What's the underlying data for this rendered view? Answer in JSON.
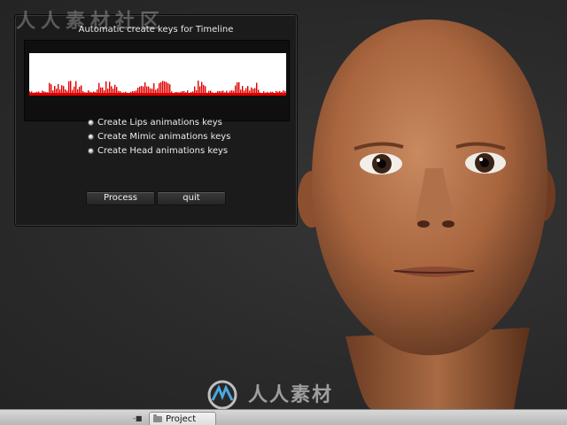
{
  "panel": {
    "title": "Automatic create keys for Timeline",
    "options": [
      {
        "label": "Create Lips animations keys",
        "selected": true
      },
      {
        "label": "Create Mimic animations keys",
        "selected": true
      },
      {
        "label": "Create Head animations keys",
        "selected": true
      }
    ],
    "buttons": {
      "process": "Process",
      "quit": "quit"
    }
  },
  "statusbar": {
    "collapse_glyph": "-■",
    "project_tab": "Project"
  },
  "watermark": {
    "top": "人人素材社区",
    "bottom": "人人素材"
  },
  "colors": {
    "waveform": "#e00000",
    "waveform_bg": "#ffffff",
    "skin": "#b5734c"
  },
  "icons": [
    "radio-icon",
    "folder-icon",
    "watermark-logo-icon"
  ]
}
